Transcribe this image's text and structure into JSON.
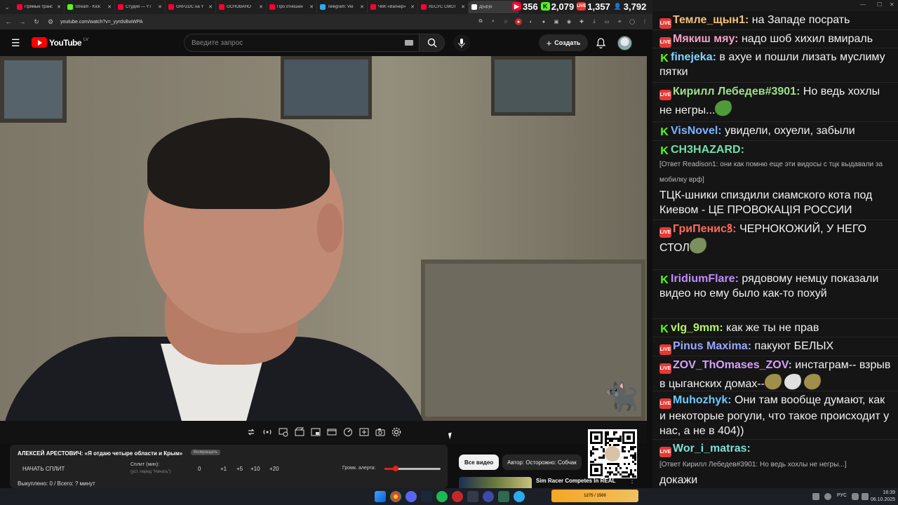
{
  "browser": {
    "tabs": [
      {
        "title": "Прямые транс",
        "color": "#ff0033",
        "active": false
      },
      {
        "title": "Stream - Kick",
        "color": "#53fc18",
        "active": false
      },
      {
        "title": "Студия — YT",
        "color": "#ff0033",
        "active": false
      },
      {
        "title": "GRPZDC на Y",
        "color": "#ff0033",
        "active": false
      },
      {
        "title": "ОСНОВАНО",
        "color": "#ff0033",
        "active": false
      },
      {
        "title": "Про отношен",
        "color": "#ff0033",
        "active": false
      },
      {
        "title": "Telegram: Vie",
        "color": "#2aabee",
        "active": false
      },
      {
        "title": "ЧВК «Вагнер»",
        "color": "#ff0033",
        "active": false
      },
      {
        "title": "ХЕСУС СМОТ",
        "color": "#ff0033",
        "active": false
      },
      {
        "title": "Д[ыр]а",
        "color": "#ffffff",
        "active": true
      }
    ],
    "url": "youtube.com/watch?v=_yyrdsBwWPA"
  },
  "counters": {
    "youtube": "356",
    "kick": "2,079",
    "vk": "1,357",
    "total": "3,792"
  },
  "youtube": {
    "logo_text": "YouTube",
    "region": "LV",
    "search_placeholder": "Введите запрос",
    "create_label": "Создать"
  },
  "split_panel": {
    "title": "АЛЕКСЕЙ АРЕСТОВИЧ: «Я отдаю четыре области и Крым»",
    "badge": "Возвращать",
    "start_label": "НАЧАТЬ СПЛИТ",
    "split_label": "Сплит (мин):",
    "split_hint": "(уст. перед \"Начать\")",
    "values": [
      "0",
      "+1",
      "+5",
      "+10",
      "+20"
    ],
    "alert_label": "Громк. алерта:",
    "alert_volume": 0.2,
    "bought_text": "Выкуплено: 0 / Всего: ? минут"
  },
  "side": {
    "chip_all": "Все видео",
    "chip_author": "Автор: Осторожно: Собчак",
    "rec_title": "Sim Racer Competes In REAL"
  },
  "chat": {
    "messages": [
      {
        "platform": "live",
        "nick": "Темле_щын1",
        "nick_color": "#f4c27a",
        "text": "на Западе посрать"
      },
      {
        "platform": "live",
        "nick": "Мякиш мяу",
        "nick_color": "#f2a0c8",
        "text": "надо шоб хихил вмираль"
      },
      {
        "platform": "kick",
        "nick": "finejeka",
        "nick_color": "#7fd6ff",
        "text": "в ахуе и пошли лизать муслиму пятки"
      },
      {
        "platform": "live",
        "nick": "Кирилл Лебедев#3901",
        "nick_color": "#9fe08a",
        "text": "Но ведь хохлы не негры..."
      },
      {
        "platform": "kick",
        "nick": "VisNovel",
        "nick_color": "#7fb2ff",
        "text": "увидели, охуели, забыли"
      },
      {
        "platform": "kick",
        "nick": "CH3HAZARD",
        "nick_color": "#6fe0b0",
        "reply": "[Ответ Readison1: они как помню еще эти видосы с тцк выдавали за мобилку врф]",
        "text": "ТЦК-шники спиздили сиамского кота под Киевом - ЦЕ ПРОВОКАЦІЯ РОССИИ"
      },
      {
        "platform": "live",
        "nick": "ГриПенисꝸ",
        "nick_color": "#ff6a5c",
        "text": "ЧЕРНОКОЖИЙ, У НЕГО СТОЛ"
      },
      {
        "platform": "kick",
        "nick": "IridiumFlare",
        "nick_color": "#c08cff",
        "text": "рядовому немцу показали видео но ему было как-то похуй"
      },
      {
        "platform": "kick",
        "nick": "vlg_9mm",
        "nick_color": "#b6f26a",
        "text": "как же ты не прав"
      },
      {
        "platform": "live",
        "nick": "Pinus Maxima",
        "nick_color": "#9aa8ff",
        "text": "пакуют БЕЛЫХ"
      },
      {
        "platform": "live",
        "nick": "ZOV_ThOmases_ZOV",
        "nick_color": "#d7a0ff",
        "text": "инстаграм-- взрыв в цыганских домах--"
      },
      {
        "platform": "live",
        "nick": "Muhozhyk",
        "nick_color": "#6ec8ff",
        "text": "Они там вообще думают, как и некоторые рогули, что такое происходит у нас, а не в 404))"
      },
      {
        "platform": "live",
        "nick": "Wor_i_matras",
        "nick_color": "#7ee0d0",
        "reply": "[Ответ Кирилл Лебедев#3901: Но ведь хохлы не негры...]",
        "text": "докажи"
      }
    ]
  },
  "taskbar": {
    "lang": "РУС",
    "time": "16:39",
    "date": "06.10.2025",
    "widget_text": "1275 / 1500"
  }
}
